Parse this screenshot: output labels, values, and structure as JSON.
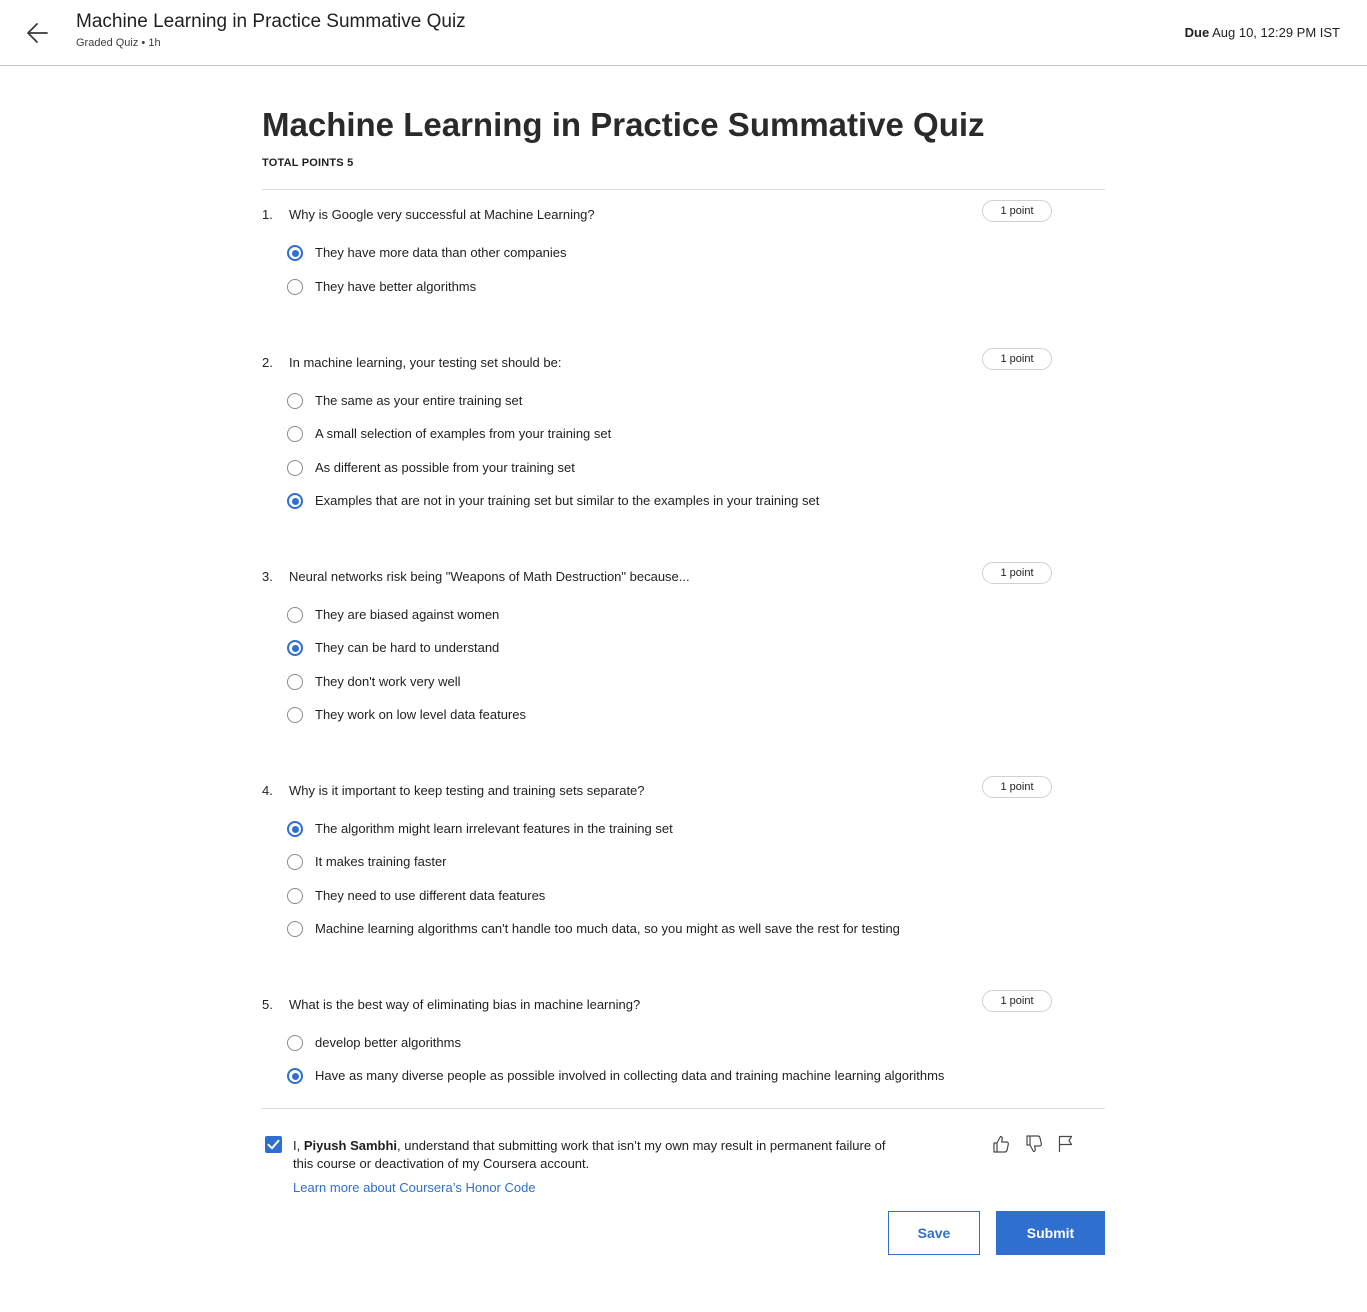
{
  "header": {
    "title": "Machine Learning in Practice Summative Quiz",
    "subtitle": "Graded Quiz • 1h",
    "due_label": "Due",
    "due_value": "Aug 10, 12:29 PM IST"
  },
  "quiz": {
    "title": "Machine Learning in Practice Summative Quiz",
    "total_points": "TOTAL POINTS 5"
  },
  "questions": [
    {
      "number": "1.",
      "text": "Why is Google very successful at Machine Learning?",
      "points": "1 point",
      "options": [
        {
          "label": "They have more data than other companies",
          "selected": true
        },
        {
          "label": "They have better algorithms",
          "selected": false
        }
      ]
    },
    {
      "number": "2.",
      "text": "In machine learning, your testing set should be:",
      "points": "1 point",
      "options": [
        {
          "label": "The same as your entire training set",
          "selected": false
        },
        {
          "label": "A small selection of examples from your training set",
          "selected": false
        },
        {
          "label": "As different as possible from your training set",
          "selected": false
        },
        {
          "label": "Examples that are not in your training set but similar to the examples in your training set",
          "selected": true
        }
      ]
    },
    {
      "number": "3.",
      "text": "Neural networks risk being \"Weapons of Math Destruction\" because...",
      "points": "1 point",
      "options": [
        {
          "label": "They are biased against women",
          "selected": false
        },
        {
          "label": "They can be hard to understand",
          "selected": true
        },
        {
          "label": "They don't work very well",
          "selected": false
        },
        {
          "label": "They work on low level data features",
          "selected": false
        }
      ]
    },
    {
      "number": "4.",
      "text": "Why is it important to keep testing and training sets separate?",
      "points": "1 point",
      "options": [
        {
          "label": "The algorithm might learn irrelevant features in the training set",
          "selected": true
        },
        {
          "label": "It makes training faster",
          "selected": false
        },
        {
          "label": "They need to use different data features",
          "selected": false
        },
        {
          "label": "Machine learning algorithms can't handle too much data, so you might as well save the rest for testing",
          "selected": false
        }
      ]
    },
    {
      "number": "5.",
      "text": "What is the best way of eliminating bias in machine learning?",
      "points": "1 point",
      "options": [
        {
          "label": "develop better algorithms",
          "selected": false
        },
        {
          "label": "Have as many diverse people as possible involved in collecting data and training machine learning algorithms",
          "selected": true
        }
      ]
    }
  ],
  "honor": {
    "checked": true,
    "prefix": "I, ",
    "name": "Piyush Sambhi",
    "suffix": ", understand that submitting work that isn’t my own may result in permanent failure of this course or deactivation of my Coursera account.",
    "link_label": "Learn more about Coursera’s Honor Code"
  },
  "feedback": {
    "like_icon": "thumbs-up-icon",
    "dislike_icon": "thumbs-down-icon",
    "flag_icon": "flag-icon"
  },
  "actions": {
    "save_label": "Save",
    "submit_label": "Submit"
  },
  "colors": {
    "accent": "#2f6fd0",
    "border": "#c8c8c8"
  }
}
